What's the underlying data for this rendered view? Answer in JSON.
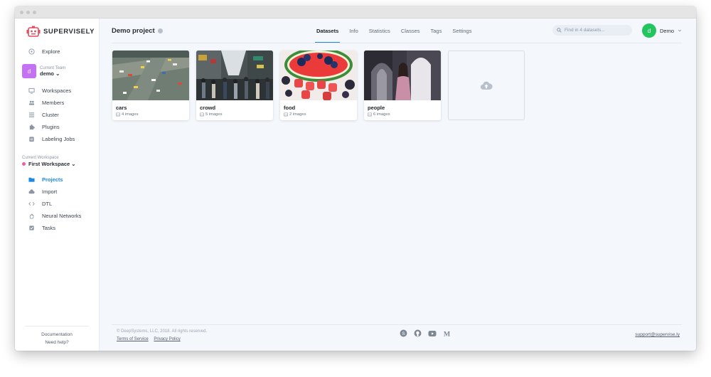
{
  "brand": {
    "name": "SUPERVISELY",
    "accent": "#1e88e5"
  },
  "sidebar": {
    "explore": "Explore",
    "team": {
      "initial": "d",
      "label": "Current Team",
      "name": "demo ⌄"
    },
    "team_items": [
      {
        "label": "Workspaces",
        "icon": "monitor-icon"
      },
      {
        "label": "Members",
        "icon": "people-icon"
      },
      {
        "label": "Cluster",
        "icon": "list-icon"
      },
      {
        "label": "Plugins",
        "icon": "puzzle-icon"
      },
      {
        "label": "Labeling Jobs",
        "icon": "clipboard-icon"
      }
    ],
    "workspace": {
      "label": "Current Workspace",
      "name": "First Workspace ⌄"
    },
    "workspace_items": [
      {
        "label": "Projects",
        "icon": "folder-icon",
        "active": true
      },
      {
        "label": "Import",
        "icon": "cloud-upload-icon"
      },
      {
        "label": "DTL",
        "icon": "code-icon"
      },
      {
        "label": "Neural Networks",
        "icon": "hand-icon"
      },
      {
        "label": "Tasks",
        "icon": "checklist-icon"
      }
    ],
    "footer": {
      "documentation": "Documentation",
      "help": "Need help?"
    }
  },
  "header": {
    "project_title": "Demo project",
    "tabs": [
      "Datasets",
      "Info",
      "Statistics",
      "Classes",
      "Tags",
      "Settings"
    ],
    "active_tab": "Datasets",
    "search_placeholder": "Find in 4 datasets...",
    "user": {
      "initial": "d",
      "name": "Demo"
    }
  },
  "datasets": [
    {
      "name": "cars",
      "count": "4 images"
    },
    {
      "name": "crowd",
      "count": "5 images"
    },
    {
      "name": "food",
      "count": "2 images"
    },
    {
      "name": "people",
      "count": "6 images"
    }
  ],
  "footer": {
    "copyright": "© DeepSystems, LLC, 2018. All rights reserved.",
    "terms": "Terms of Service",
    "privacy": "Privacy Policy",
    "support": "support@supervise.ly"
  }
}
